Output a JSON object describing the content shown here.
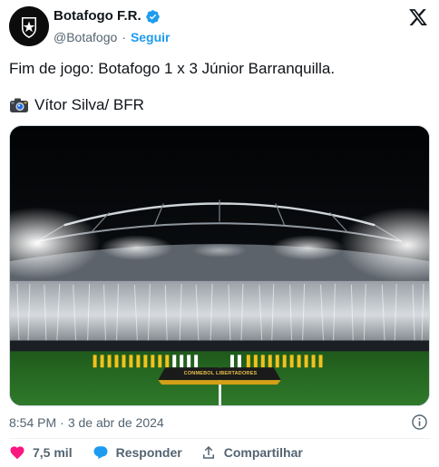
{
  "account": {
    "display_name": "Botafogo F.R.",
    "handle": "@Botafogo",
    "separator": "·",
    "follow_label": "Seguir"
  },
  "tweet": {
    "text": "Fim de jogo: Botafogo 1 x 3 Júnior Barranquilla.",
    "credit": "Vítor Silva/ BFR"
  },
  "photo": {
    "banner_text": "CONMEBOL LIBERTADORES"
  },
  "meta": {
    "time": "8:54 PM",
    "separator": "·",
    "date": "3 de abr de 2024"
  },
  "actions": {
    "likes": "7,5 mil",
    "reply_label": "Responder",
    "share_label": "Compartilhar"
  },
  "colors": {
    "accent": "#1d9bf0",
    "like": "#f91880",
    "secondary_text": "#536471",
    "primary_text": "#0f1419"
  },
  "icons": [
    "botafogo-crest-icon",
    "verified-badge-icon",
    "x-logo-icon",
    "camera-icon",
    "info-icon",
    "heart-icon",
    "reply-icon",
    "share-icon"
  ]
}
